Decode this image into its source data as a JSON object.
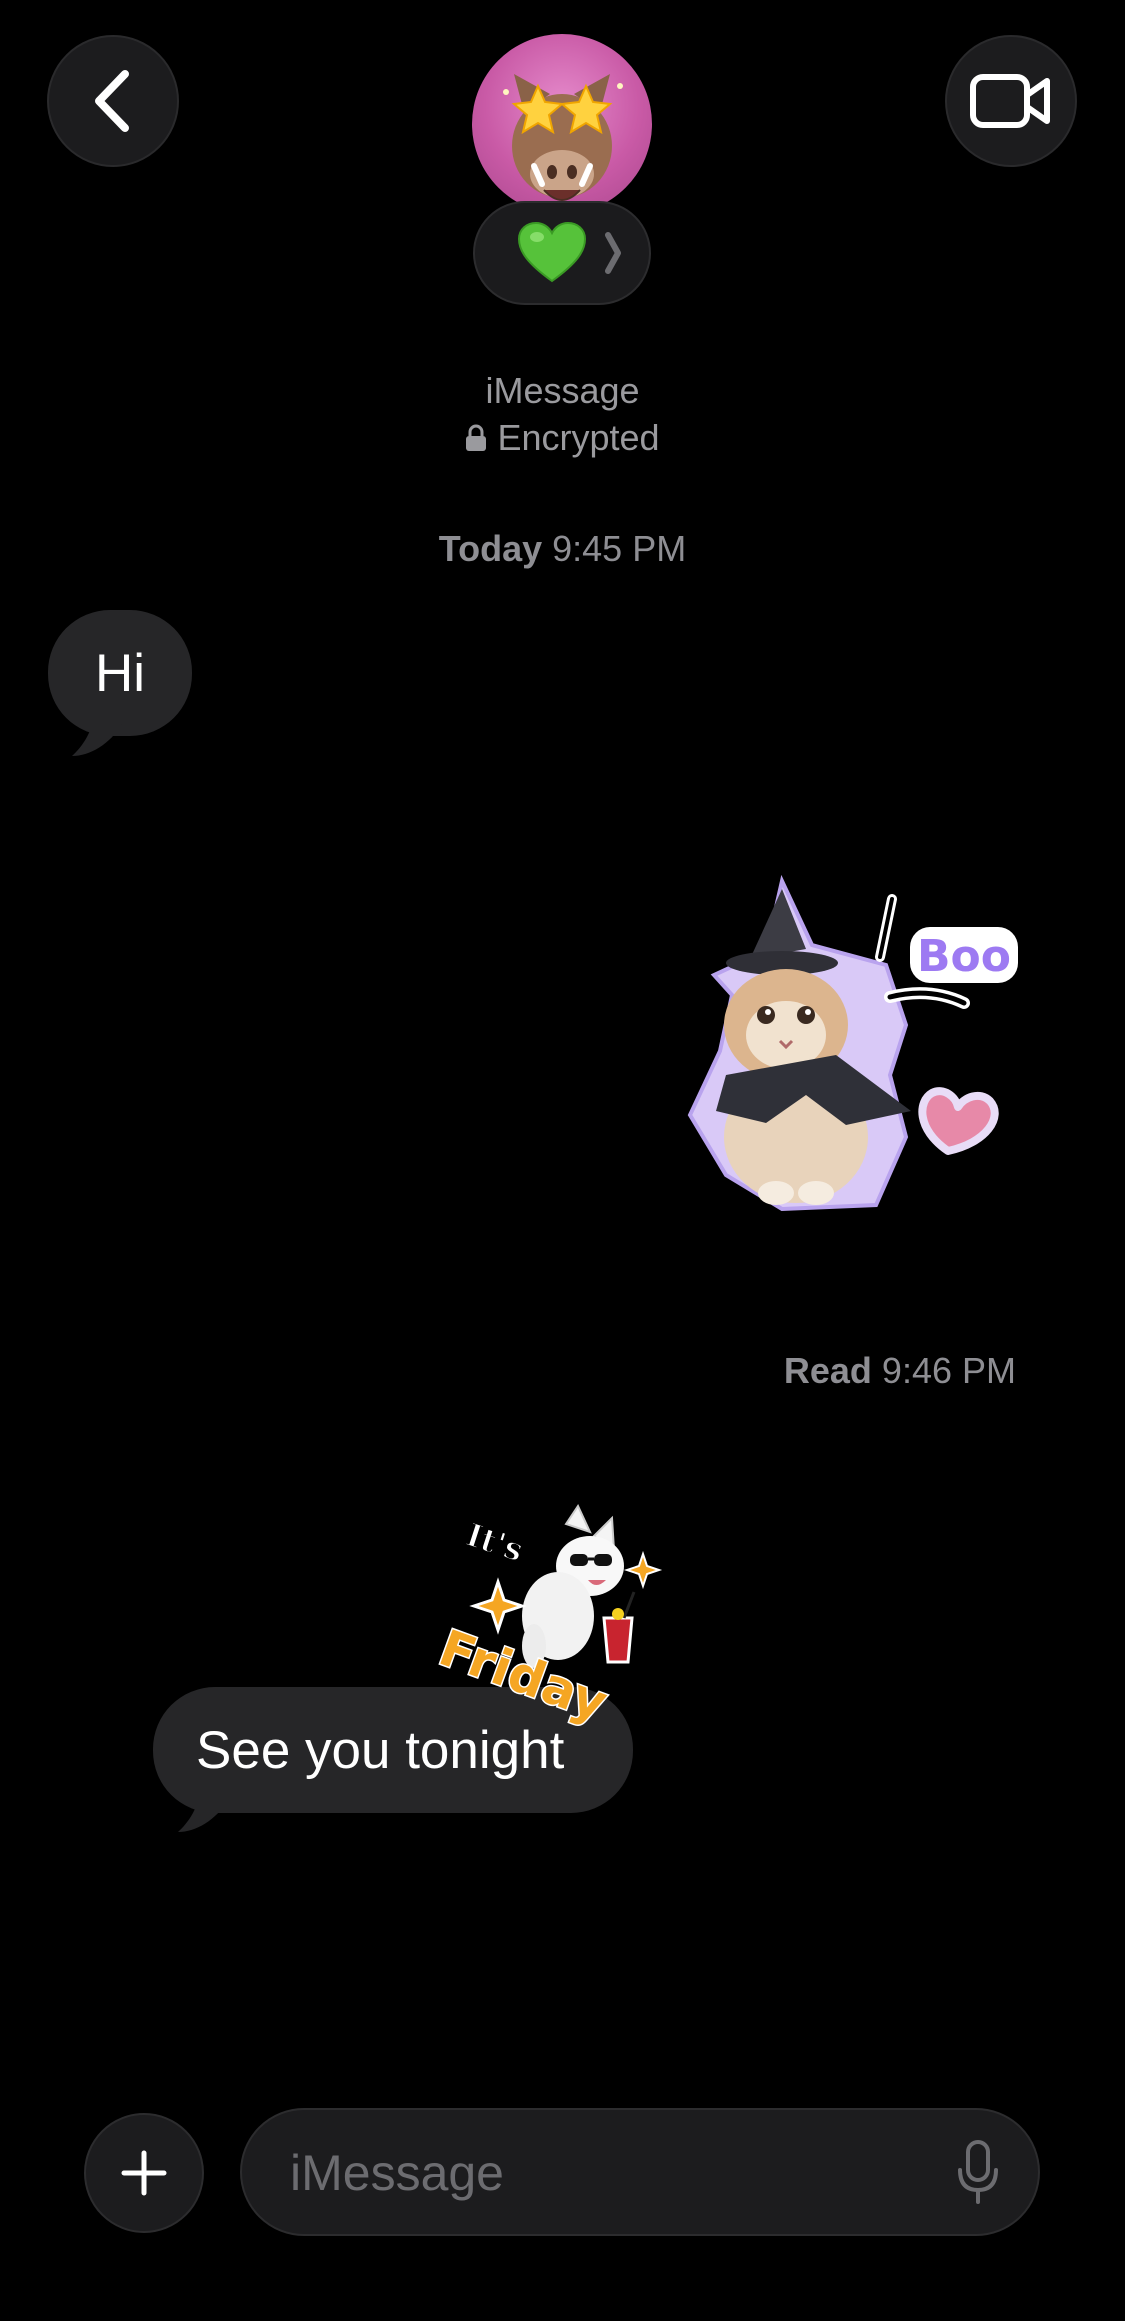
{
  "header": {
    "back_icon": "chevron-left-icon",
    "video_icon": "video-camera-icon",
    "contact_avatar": "boar-memoji-star-eyes",
    "status_emoji": "💚",
    "status_chevron": "›"
  },
  "conversation": {
    "service": "iMessage",
    "encryption": "Encrypted",
    "timestamp_day": "Today",
    "timestamp_time": "9:45 PM",
    "messages": [
      {
        "side": "received",
        "text": "Hi"
      },
      {
        "side": "sent",
        "sticker": "kitten-witch-hat-boo-sticker",
        "sticker_text": "Boo"
      },
      {
        "side": "received",
        "text": "See you tonight",
        "sticker": "dog-its-friday-sticker",
        "sticker_text": [
          "It's",
          "Friday"
        ]
      }
    ],
    "read_label": "Read",
    "read_time": "9:46 PM"
  },
  "composer": {
    "add_icon": "plus-icon",
    "placeholder": "iMessage",
    "mic_icon": "microphone-icon"
  },
  "colors": {
    "background": "#000000",
    "bubble": "#262628",
    "secondary_text": "#8e8e93",
    "avatar_pink": "#d46fb8",
    "sticker_outline": "#c9b6f2",
    "boo_purple": "#9d7af2",
    "friday_orange": "#f5a623"
  }
}
